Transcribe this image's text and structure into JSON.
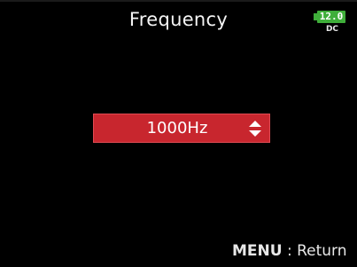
{
  "header": {
    "title": "Frequency"
  },
  "power": {
    "voltage": "12.0",
    "source": "DC",
    "color": "#3fae3a"
  },
  "setting": {
    "value": "1000Hz",
    "control_icon": "up-down-arrows-icon",
    "highlight_color": "#c8262e"
  },
  "footer": {
    "key": "MENU",
    "separator": " : ",
    "action": "Return"
  }
}
